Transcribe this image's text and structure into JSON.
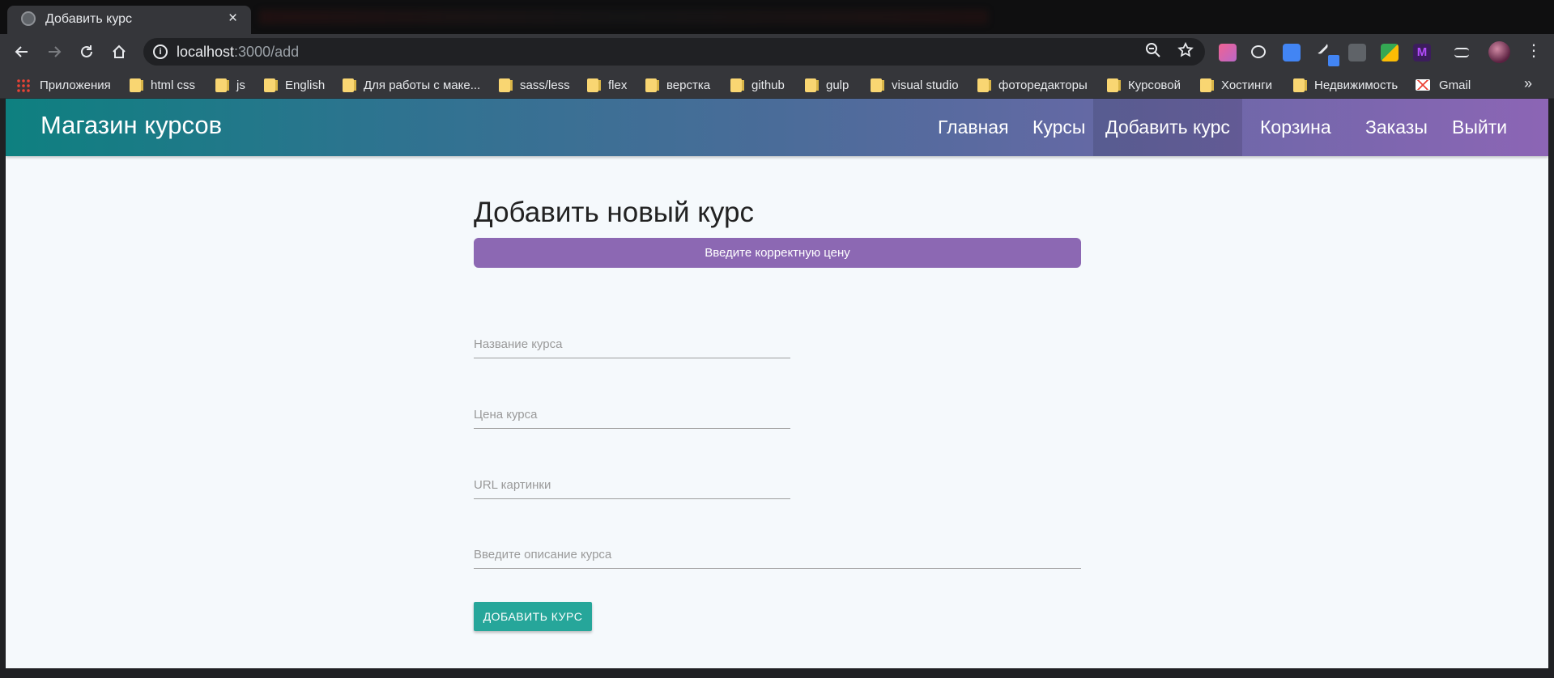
{
  "browser": {
    "tab_title": "Добавить курс",
    "tab_close": "×",
    "url_host": "localhost",
    "url_rest": ":3000/add",
    "bookmarks": [
      {
        "label": "Приложения",
        "icon": "apps-icon"
      },
      {
        "label": "html css",
        "icon": "folder-icon"
      },
      {
        "label": "js",
        "icon": "folder-icon"
      },
      {
        "label": "English",
        "icon": "folder-icon"
      },
      {
        "label": "Для работы с маке...",
        "icon": "folder-icon"
      },
      {
        "label": "sass/less",
        "icon": "folder-icon"
      },
      {
        "label": "flex",
        "icon": "folder-icon"
      },
      {
        "label": "верстка",
        "icon": "folder-icon"
      },
      {
        "label": "github",
        "icon": "folder-icon"
      },
      {
        "label": "gulp",
        "icon": "folder-icon"
      },
      {
        "label": "visual studio",
        "icon": "folder-icon"
      },
      {
        "label": "фоторедакторы",
        "icon": "folder-icon"
      },
      {
        "label": "Курсовой",
        "icon": "folder-icon"
      },
      {
        "label": "Хостинги",
        "icon": "folder-icon"
      },
      {
        "label": "Недвижимость",
        "icon": "folder-icon"
      },
      {
        "label": "Gmail",
        "icon": "gmail-icon"
      }
    ],
    "bookmarks_more": "»"
  },
  "navbar": {
    "brand": "Магазин курсов",
    "links": [
      {
        "label": "Главная",
        "active": false
      },
      {
        "label": "Курсы",
        "active": false
      },
      {
        "label": "Добавить курс",
        "active": true
      },
      {
        "label": "Корзина",
        "active": false
      },
      {
        "label": "Заказы",
        "active": false
      },
      {
        "label": "Выйти",
        "active": false
      }
    ],
    "gradient_start": "#0e8080",
    "gradient_end": "#8c65b5"
  },
  "main": {
    "title": "Добавить новый курс",
    "alert": "Введите корректную цену",
    "alert_color": "#8c68b3",
    "fields": {
      "title_placeholder": "Название курса",
      "price_placeholder": "Цена курса",
      "img_placeholder": "URL картинки",
      "description_placeholder": "Введите описание курса"
    },
    "submit_label": "Добавить курс",
    "submit_color": "#26a69a"
  }
}
